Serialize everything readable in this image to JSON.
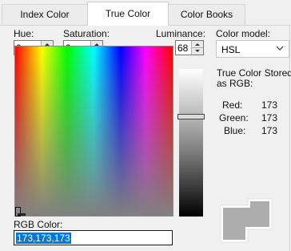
{
  "tabs": [
    {
      "label": "Index Color",
      "active": false
    },
    {
      "label": "True Color",
      "active": true
    },
    {
      "label": "Color Books",
      "active": false
    }
  ],
  "hue": {
    "label": "Hue:",
    "value": "0"
  },
  "saturation": {
    "label": "Saturation:",
    "value": "0"
  },
  "luminance": {
    "label": "Luminance:",
    "value": "68"
  },
  "color_model": {
    "label": "Color model:",
    "selected": "HSL"
  },
  "stored": {
    "caption_line1": "True Color Stored",
    "caption_line2": "as RGB:",
    "red": {
      "label": "Red:",
      "value": "173"
    },
    "green": {
      "label": "Green:",
      "value": "173"
    },
    "blue": {
      "label": "Blue:",
      "value": "173"
    }
  },
  "rgb_color": {
    "label": "RGB Color:",
    "value": "173,173,173"
  },
  "colors": {
    "current": "#adadad",
    "selection": "#0078d7"
  },
  "icons": {
    "spin_up": "up-arrow",
    "spin_down": "down-arrow",
    "select": "chevron-down"
  }
}
